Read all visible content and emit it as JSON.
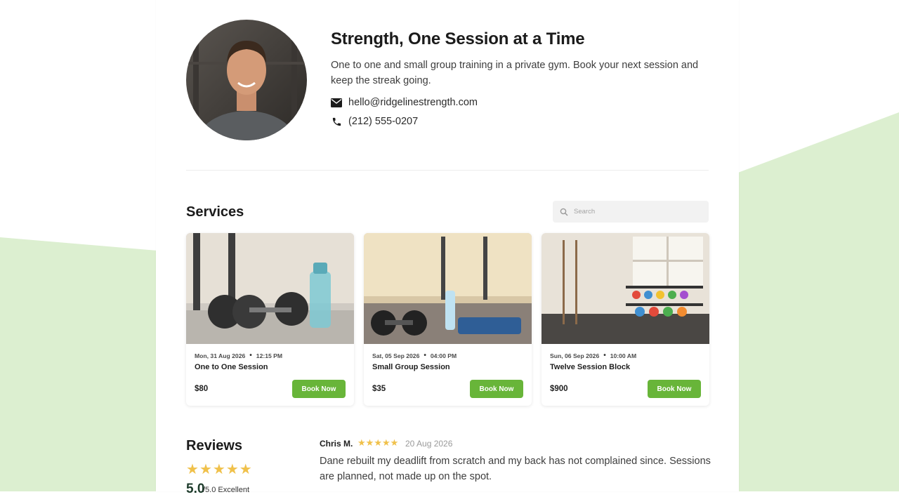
{
  "profile": {
    "headline": "Strength, One Session at a Time",
    "tagline": "One to one and small group training in a private gym. Book your next session and keep the streak going.",
    "email": "hello@ridgelinestrength.com",
    "phone": "(212) 555-0207",
    "icons": {
      "email": "envelope-icon",
      "phone": "phone-icon"
    }
  },
  "services": {
    "title": "Services",
    "search_placeholder": "Search",
    "cards": [
      {
        "date": "Mon, 31 Aug 2026",
        "time": "12:15 PM",
        "name": "One to One Session",
        "price": "$80",
        "button": "Book Now"
      },
      {
        "date": "Sat, 05 Sep 2026",
        "time": "04:00 PM",
        "name": "Small Group Session",
        "price": "$35",
        "button": "Book Now"
      },
      {
        "date": "Sun, 06 Sep 2026",
        "time": "10:00 AM",
        "name": "Twelve Session Block",
        "price": "$900",
        "button": "Book Now"
      }
    ]
  },
  "reviews": {
    "title": "Reviews",
    "overall_score": "5.0",
    "overall_suffix": "/5.0 Excellent",
    "overall_rating": 5,
    "items": [
      {
        "author": "Chris M.",
        "rating": 5,
        "date": "20 Aug 2026",
        "text": "Dane rebuilt my deadlift from scratch and my back has not complained since. Sessions are planned, not made up on the spot."
      }
    ]
  },
  "colors": {
    "accent": "#68b539",
    "star": "#f0c14b",
    "background_green": "#dcefd0"
  }
}
